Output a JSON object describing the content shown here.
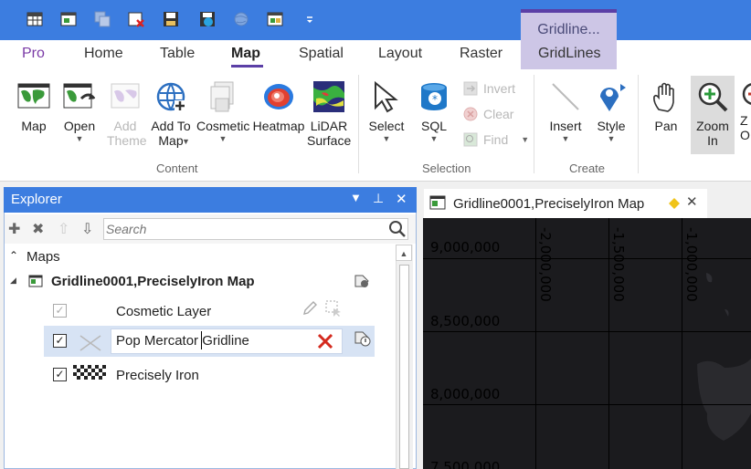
{
  "quick_access": {
    "icons": [
      "table-grid-icon",
      "window-layout-icon",
      "table-copy-icon",
      "close-table-icon",
      "save-icon",
      "save-workspace-icon",
      "globe-icon",
      "layout-print-icon",
      "customize-menu-icon"
    ]
  },
  "context_tab_group": "Gridline...",
  "tabs": [
    {
      "label": "Pro"
    },
    {
      "label": "Home"
    },
    {
      "label": "Table"
    },
    {
      "label": "Map",
      "active": true
    },
    {
      "label": "Spatial"
    },
    {
      "label": "Layout"
    },
    {
      "label": "Raster"
    },
    {
      "label": "GridLines"
    }
  ],
  "ribbon": {
    "content": {
      "label": "Content",
      "map": "Map",
      "open": "Open",
      "add_theme": "Add Theme",
      "add_to_map": "Add To Map",
      "cosmetic": "Cosmetic",
      "heatmap": "Heatmap",
      "lidar_surface": "LiDAR Surface"
    },
    "selection": {
      "label": "Selection",
      "select": "Select",
      "sql": "SQL",
      "invert": "Invert",
      "clear": "Clear",
      "find": "Find"
    },
    "create": {
      "label": "Create",
      "insert": "Insert",
      "style": "Style"
    },
    "nav": {
      "pan": "Pan",
      "zoom_in": "Zoom In",
      "zoom_out_partial": "Z O"
    }
  },
  "explorer": {
    "title": "Explorer",
    "search_placeholder": "Search",
    "maps_header": "Maps",
    "map_name": "Gridline0001,PreciselyIron Map",
    "layers": [
      {
        "name": "Cosmetic Layer",
        "checked": true,
        "enabled": false
      },
      {
        "name": "Pop Mercator Gridline",
        "checked": true,
        "editing": true
      },
      {
        "name": "Precisely Iron",
        "checked": true
      }
    ]
  },
  "map_window": {
    "tab_title": "Gridline0001,PreciselyIron Map",
    "y_labels": [
      "9,000,000",
      "8,500,000",
      "8,000,000",
      "7,500,000"
    ],
    "x_labels": [
      "-2,000,000",
      "-1,500,000",
      "-1,000,000"
    ]
  },
  "colors": {
    "title_bar": "#3c7de0",
    "accent": "#5b3fa6",
    "context_band": "#cdc6e6",
    "map_background": "#1b1b1e",
    "selection_row": "#d7e3f4"
  }
}
